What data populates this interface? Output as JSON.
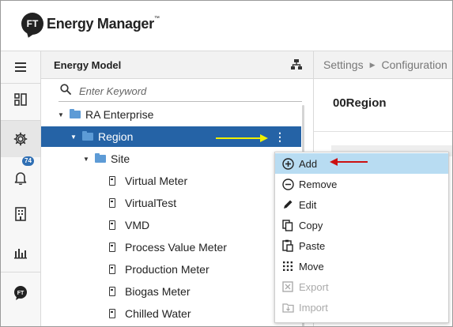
{
  "app": {
    "logo_initials": "FT",
    "logo_text": "Energy Manager",
    "logo_tm": "™"
  },
  "rail": {
    "notification_count": "74",
    "items": [
      {
        "name": "menu-icon"
      },
      {
        "name": "dashboard-icon"
      },
      {
        "name": "settings-icon",
        "active": true
      },
      {
        "name": "notifications-icon"
      },
      {
        "name": "building-icon"
      },
      {
        "name": "reports-icon"
      },
      {
        "name": "ft-logo-icon"
      }
    ]
  },
  "tree_panel": {
    "title": "Energy Model",
    "search_placeholder": "Enter Keyword",
    "nodes": [
      {
        "label": "RA Enterprise",
        "type": "folder",
        "depth": 1
      },
      {
        "label": "Region",
        "type": "folder",
        "depth": 2,
        "selected": true
      },
      {
        "label": "Site",
        "type": "folder",
        "depth": 3
      },
      {
        "label": "Virtual Meter",
        "type": "meter",
        "depth": 4
      },
      {
        "label": "VirtualTest",
        "type": "meter",
        "depth": 4
      },
      {
        "label": "VMD",
        "type": "meter",
        "depth": 4
      },
      {
        "label": "Process Value Meter",
        "type": "meter",
        "depth": 4
      },
      {
        "label": "Production Meter",
        "type": "meter",
        "depth": 4
      },
      {
        "label": "Biogas Meter",
        "type": "meter",
        "depth": 4
      },
      {
        "label": "Chilled Water",
        "type": "meter",
        "depth": 4
      }
    ]
  },
  "breadcrumb": {
    "items": [
      "Settings",
      "Configuration"
    ]
  },
  "content": {
    "title": "00Region"
  },
  "context_menu": {
    "items": [
      {
        "label": "Add",
        "icon": "plus-circle-icon",
        "state": "hover"
      },
      {
        "label": "Remove",
        "icon": "minus-circle-icon",
        "state": "normal"
      },
      {
        "label": "Edit",
        "icon": "pencil-icon",
        "state": "normal"
      },
      {
        "label": "Copy",
        "icon": "copy-icon",
        "state": "normal"
      },
      {
        "label": "Paste",
        "icon": "paste-icon",
        "state": "normal"
      },
      {
        "label": "Move",
        "icon": "move-icon",
        "state": "normal"
      },
      {
        "label": "Export",
        "icon": "export-icon",
        "state": "disabled"
      },
      {
        "label": "Import",
        "icon": "import-icon",
        "state": "disabled"
      }
    ]
  },
  "colors": {
    "selected_row": "#2563a6",
    "menu_hover": "#b8dcf2",
    "folder": "#5d9bd6",
    "badge": "#2f6fb4",
    "annotation_arrow_yellow": "#f0f000",
    "annotation_arrow_red": "#cc1111"
  }
}
